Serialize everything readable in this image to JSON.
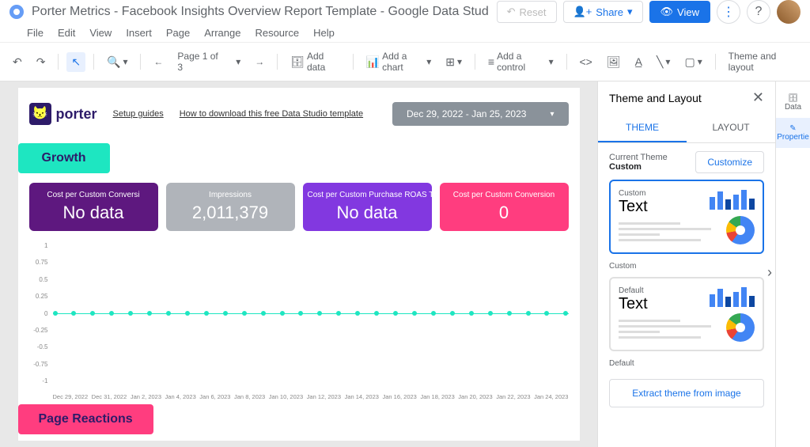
{
  "header": {
    "title": "Porter Metrics - Facebook Insights Overview Report Template - Google Data Stud",
    "reset": "Reset",
    "share": "Share",
    "view": "View"
  },
  "menu": [
    "File",
    "Edit",
    "View",
    "Insert",
    "Page",
    "Arrange",
    "Resource",
    "Help"
  ],
  "toolbar": {
    "pager": "Page 1 of 3",
    "add_data": "Add data",
    "add_chart": "Add a chart",
    "add_control": "Add a control",
    "theme_layout": "Theme and layout"
  },
  "report": {
    "brand": "porter",
    "link1": "Setup guides",
    "link2": "How to download this free Data Studio template",
    "date_range": "Dec 29, 2022 - Jan 25, 2023",
    "section_growth": "Growth",
    "section_reactions": "Page Reactions",
    "cards": [
      {
        "title": "Cost per Custom Conversi",
        "value": "No data"
      },
      {
        "title": "Impressions",
        "value": "2,011,379"
      },
      {
        "title": "Cost per Custom Purchase ROAS Total Managed Conversions",
        "value": "No data"
      },
      {
        "title": "Cost per Custom Conversion",
        "value": "0"
      }
    ]
  },
  "chart_data": {
    "type": "line",
    "title": "",
    "y_ticks": [
      "1",
      "0.75",
      "0.5",
      "0.25",
      "0",
      "-0.25",
      "-0.5",
      "-0.75",
      "-1"
    ],
    "x_ticks": [
      "Dec 29, 2022",
      "Dec 31, 2022",
      "Jan 2, 2023",
      "Jan 4, 2023",
      "Jan 6, 2023",
      "Jan 8, 2023",
      "Jan 10, 2023",
      "Jan 12, 2023",
      "Jan 14, 2023",
      "Jan 16, 2023",
      "Jan 18, 2023",
      "Jan 20, 2023",
      "Jan 22, 2023",
      "Jan 24, 2023"
    ],
    "series": [
      {
        "name": "metric",
        "values": [
          0,
          0,
          0,
          0,
          0,
          0,
          0,
          0,
          0,
          0,
          0,
          0,
          0,
          0,
          0,
          0,
          0,
          0,
          0,
          0,
          0,
          0,
          0,
          0,
          0,
          0,
          0,
          0
        ]
      }
    ],
    "ylim": [
      -1,
      1
    ]
  },
  "panel": {
    "title": "Theme and Layout",
    "tab_theme": "THEME",
    "tab_layout": "LAYOUT",
    "current_label": "Current Theme",
    "current_value": "Custom",
    "customize": "Customize",
    "card_custom": "Custom",
    "card_default": "Default",
    "card_text": "Text",
    "extract": "Extract theme from image"
  },
  "rail": {
    "data": "Data",
    "properties": "Propertie"
  }
}
